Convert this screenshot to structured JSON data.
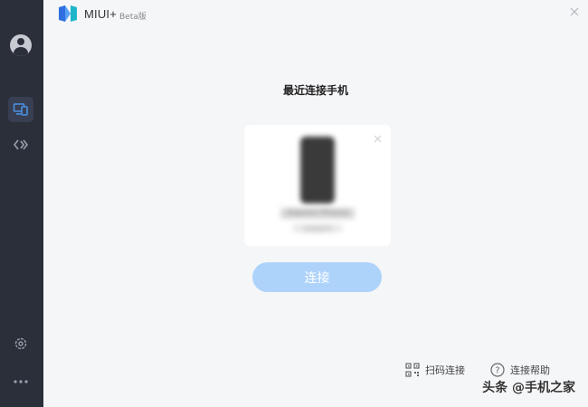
{
  "app": {
    "name": "MIUI+",
    "badge": "Beta版"
  },
  "main": {
    "title": "最近连接手机",
    "device_name": "Xiaomi Phone",
    "device_sub": "手机型号",
    "connect_label": "连接"
  },
  "footer": {
    "scan_label": "扫码连接",
    "help_label": "连接帮助"
  },
  "watermark": "头条 @手机之家",
  "colors": {
    "sidebar": "#2b2f3a",
    "accent": "#4a90e2",
    "connect_disabled": "#aed3fb"
  }
}
